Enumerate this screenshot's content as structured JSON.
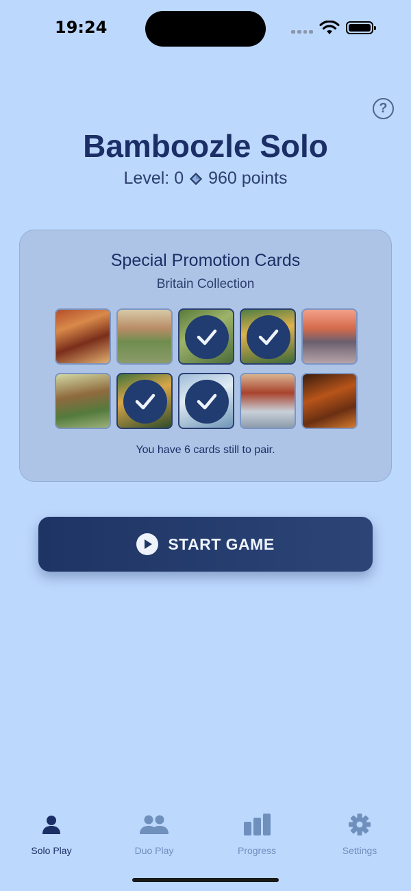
{
  "status_bar": {
    "time": "19:24"
  },
  "header": {
    "help_icon_text": "?",
    "title": "Bamboozle Solo",
    "level_text": "Level: 0",
    "points_text": "960 points"
  },
  "promo": {
    "title": "Special Promotion Cards",
    "subtitle": "Britain Collection",
    "cards": [
      {
        "paired": false
      },
      {
        "paired": false
      },
      {
        "paired": true
      },
      {
        "paired": true
      },
      {
        "paired": false
      },
      {
        "paired": false
      },
      {
        "paired": true
      },
      {
        "paired": true
      },
      {
        "paired": false
      },
      {
        "paired": false
      }
    ],
    "note": "You have 6 cards still to pair."
  },
  "start_button": {
    "label": "START GAME"
  },
  "tabs": [
    {
      "label": "Solo Play",
      "icon": "person-icon",
      "active": true
    },
    {
      "label": "Duo Play",
      "icon": "people-icon",
      "active": false
    },
    {
      "label": "Progress",
      "icon": "bar-chart-icon",
      "active": false
    },
    {
      "label": "Settings",
      "icon": "gear-icon",
      "active": false
    }
  ],
  "colors": {
    "background": "#bdd8fd",
    "primary": "#1e3464",
    "tab_inactive": "#6f8fbd"
  }
}
